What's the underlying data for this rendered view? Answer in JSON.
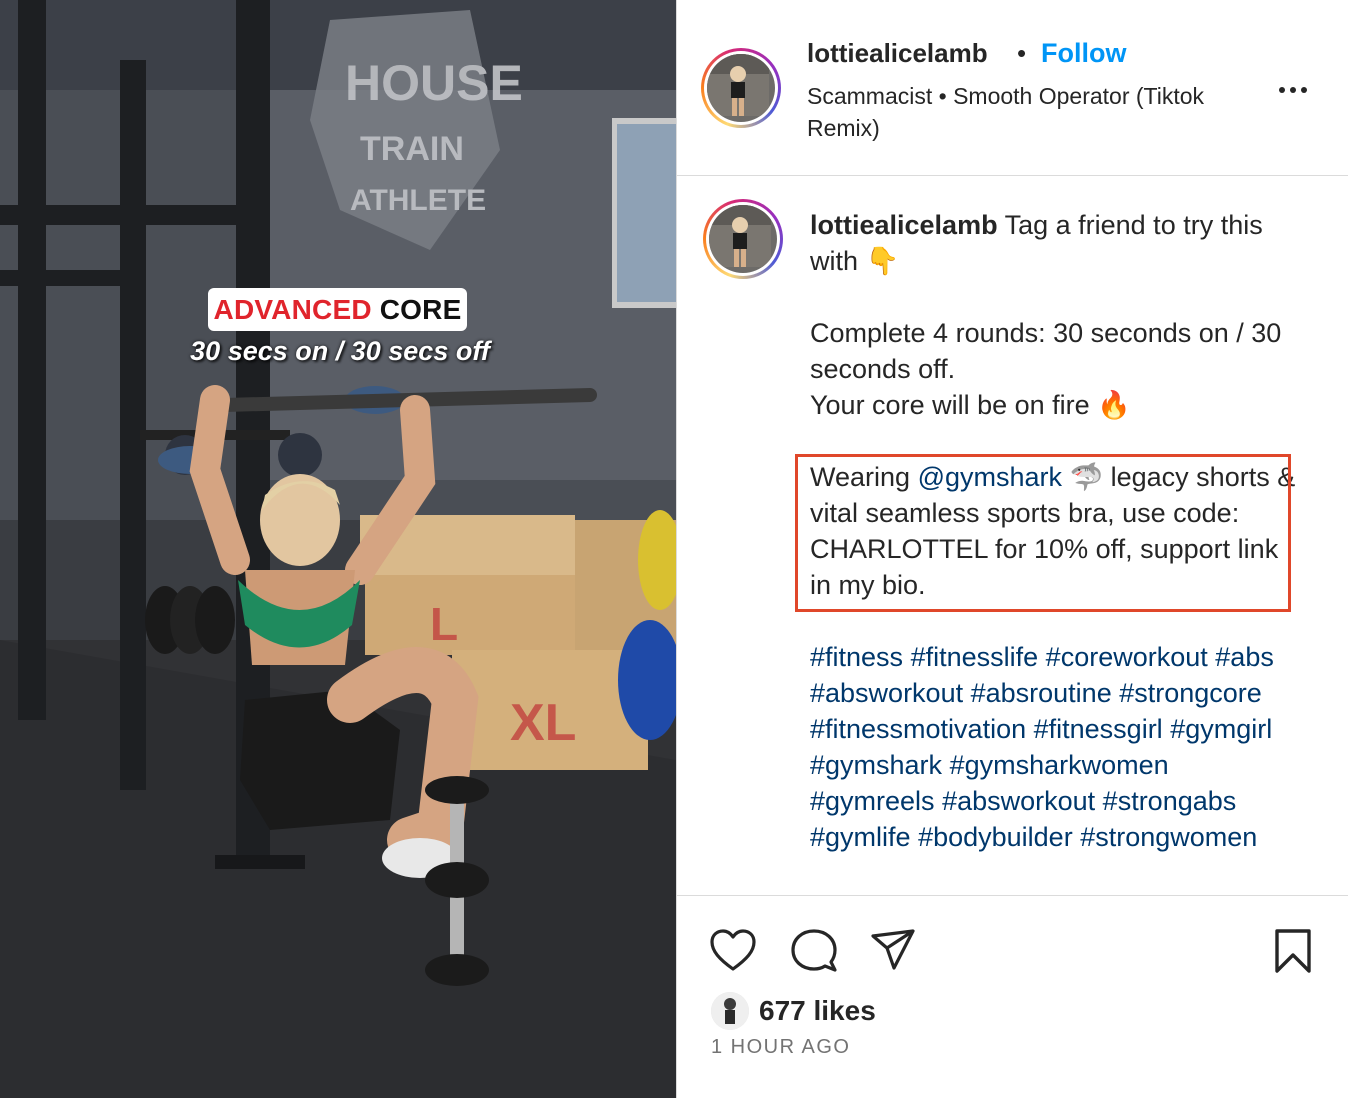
{
  "overlay": {
    "title_accent": "ADVANCED",
    "title_rest": "CORE",
    "subtitle": "30 secs on / 30 secs off"
  },
  "header": {
    "username": "lottiealicelamb",
    "separator": "•",
    "follow_label": "Follow",
    "audio": "Scammacist • Smooth Operator (Tiktok Remix)"
  },
  "caption": {
    "username": "lottiealicelamb",
    "line1": "Tag a friend to try this with 👇",
    "line2": "Complete 4 rounds: 30 seconds on / 30 seconds off.",
    "line3": "Your core will be on fire 🔥",
    "wearing_prefix": "Wearing ",
    "mention": "@gymshark",
    "wearing_suffix": " 🦈 legacy shorts & vital seamless sports bra, use code: CHARLOTTEL for 10% off, support link in my bio.",
    "hashtags": [
      "#fitness",
      "#fitnesslife",
      "#coreworkout",
      "#abs",
      "#absworkout",
      "#absroutine",
      "#strongcore",
      "#fitnessmotivation",
      "#fitnessgirl",
      "#gymgirl",
      "#gymshark",
      "#gymsharkwomen",
      "#gymreels",
      "#absworkout",
      "#strongabs",
      "#gymlife",
      "#bodybuilder",
      "#strongwomen"
    ]
  },
  "actions": {
    "likes": "677 likes",
    "time": "1 HOUR AGO"
  },
  "colors": {
    "follow": "#0095f6",
    "link": "#00376b",
    "highlight": "#e0472a",
    "overlay_red": "#e0242c"
  }
}
